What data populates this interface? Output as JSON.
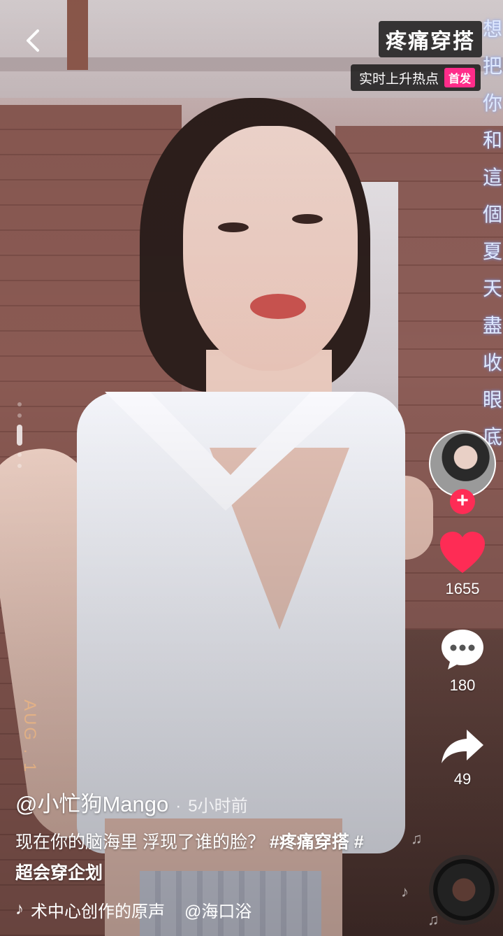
{
  "app": {
    "accent_color": "#fe2c55",
    "badge_color": "#ff2c8a"
  },
  "header": {
    "back_icon": "chevron-left-icon",
    "hot_tag": "疼痛穿搭",
    "rise_label": "实时上升热点",
    "first_badge": "首发"
  },
  "video": {
    "side_text": [
      "想",
      "把",
      "你",
      "和",
      "這",
      "個",
      "夏",
      "天",
      "盡",
      "收",
      "眼",
      "底"
    ],
    "film_stamp": "AUG . 1"
  },
  "rail": {
    "avatar_icon": "avatar",
    "follow_symbol": "+",
    "like_icon": "heart-icon",
    "like_count": "1655",
    "comment_icon": "comment-icon",
    "comment_count": "180",
    "share_icon": "share-icon",
    "share_count": "49"
  },
  "post": {
    "author": "@小忙狗Mango",
    "time_sep": "·",
    "time": "5小时前",
    "caption_text": "现在你的脑海里 浮现了谁的脸？ ",
    "hashtag1": "#疼痛穿搭",
    "hashtag2": "#超会穿企划"
  },
  "music": {
    "note_icon": "♪",
    "text": "术中心创作的原声",
    "credit": "@海口浴"
  }
}
